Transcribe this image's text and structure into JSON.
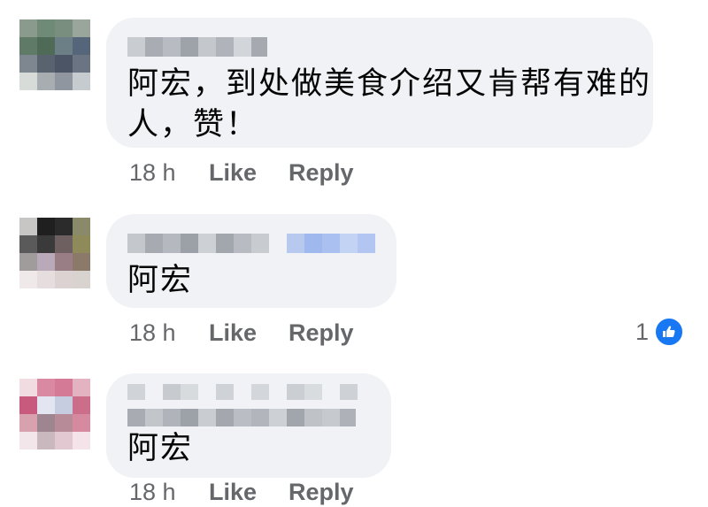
{
  "comments": [
    {
      "text_line1": "阿宏，到处做美食介绍又肯帮有难的",
      "text_line2": "人，赞！",
      "time": "18 h",
      "like": "Like",
      "reply": "Reply"
    },
    {
      "text_line1": "阿宏",
      "time": "18 h",
      "like": "Like",
      "reply": "Reply",
      "reaction_count": "1",
      "reaction_icon": "thumbs-up-icon"
    },
    {
      "text_line1": "阿宏",
      "time": "18 h",
      "like": "Like",
      "reply": "Reply"
    }
  ],
  "colors": {
    "bubble": "#f0f2f5",
    "text": "#050505",
    "meta": "#65676b",
    "like_badge": "#1877f2"
  }
}
